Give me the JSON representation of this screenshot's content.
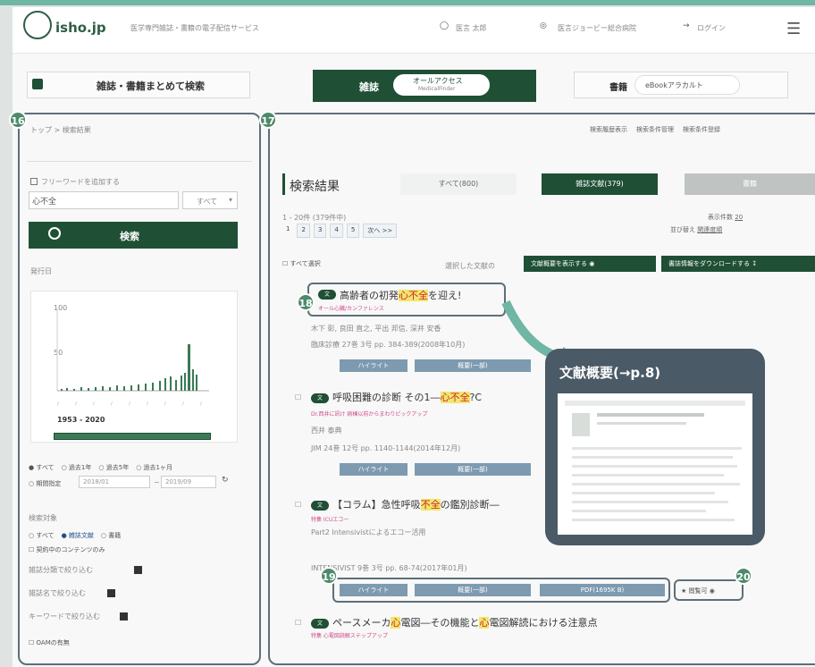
{
  "header": {
    "logo": "isho.jp",
    "tagline": "医学専門雑誌・書籍の電子配信サービス",
    "user": "医言 太郎",
    "org": "医言ジョービー総合病院",
    "login": "ログイン"
  },
  "tabs": {
    "both_label": "雑誌・書籍まとめて検索",
    "journal_label": "雑誌",
    "journal_pill": "オールアクセス",
    "journal_pill_sub": "MedicalFinder",
    "book_label": "書籍",
    "book_pill": "eBookアラカルト"
  },
  "sidebar": {
    "breadcrumb": "トップ > 検索結果",
    "freeword_label": "フリーワードを追加する",
    "search_value": "心不全",
    "scope_select": "すべて",
    "search_button": "検索",
    "pubdate_label": "発行日",
    "chart_y_100": "100",
    "chart_y_50": "50",
    "range_text": "1953 - 2020",
    "radio_options": [
      "すべて",
      "過去1年",
      "過去5年",
      "過去1ヶ月",
      "期間指定"
    ],
    "date_from": "2018/01",
    "date_to": "2019/09",
    "target_label": "検索対象",
    "target_options": [
      "すべて",
      "雑誌文献",
      "書籍"
    ],
    "target_note": "契約中のコンテンツのみ",
    "filter1": "雑誌分類で絞り込む",
    "filter2": "雑誌名で絞り込む",
    "filter3": "キーワードで絞り込む",
    "oa_label": "OAMの有無"
  },
  "main": {
    "links": [
      "検索履歴表示",
      "検索条件管理",
      "検索条件登録"
    ],
    "result_title": "検索結果",
    "tab_all": "すべて(800)",
    "tab_journal": "雑誌文献(379)",
    "tab_book": "書籍",
    "count_line": "1 - 20件 (379件中)",
    "pages": [
      "1",
      "2",
      "3",
      "4",
      "5",
      "次へ >>"
    ],
    "per_page_label": "表示件数",
    "per_page_value": "20",
    "sort_label": "並び替え",
    "sort_value": "関連度順",
    "select_all": "すべて選択",
    "selected_label": "選択した文献の",
    "show_abstract_btn": "文献概要を表示する",
    "download_btn": "書誌情報をダウンロードする",
    "results": [
      {
        "title_pre": "高齢者の初発",
        "title_hl": "心不全",
        "title_post": "を迎え!",
        "series": "オール心臓/カンファレンス",
        "authors": "木下 彰, 良田 直之, 平出 邦信, 深井 安香",
        "cite": "臨床診療 27巻 3号 pp. 384-389(2008年10月)",
        "btn1": "ハイライト",
        "btn2": "概要(一部)"
      },
      {
        "title_pre": "呼吸困難の診断 その1―",
        "title_hl": "心不全",
        "title_post": "?C",
        "series": "Dr.西井に訊け 病棟以前からまわりピックアップ",
        "authors": "西井 泰典",
        "cite": "JIM 24巻 12号 pp. 1140-1144(2014年12月)",
        "btn1": "ハイライト",
        "btn2": "概要(一部)"
      },
      {
        "title_pre": "【コラム】急性呼吸",
        "title_hl": "不全",
        "title_post": "の鑑別診断―",
        "series": "特集 ICUエコー",
        "authors": "Part2 Intensivistによるエコー活用",
        "cite": "INTENSIVIST 9巻 3号 pp. 68-74(2017年01月)",
        "btn1": "ハイライト",
        "btn2": "概要(一部)",
        "btn3": "PDF(1695K B)",
        "bookmark": "閲覧可"
      },
      {
        "title_pre": "ペースメーカ",
        "title_hl": "心",
        "title_post": "電図―その機能と",
        "title_hl2": "心",
        "title_post2": "電図解読における注意点",
        "series": "特集 心電図読解ステップアップ"
      }
    ]
  },
  "callout": {
    "title": "文献概要(→p.8)"
  },
  "markers": [
    "16",
    "17",
    "18",
    "19",
    "20"
  ]
}
